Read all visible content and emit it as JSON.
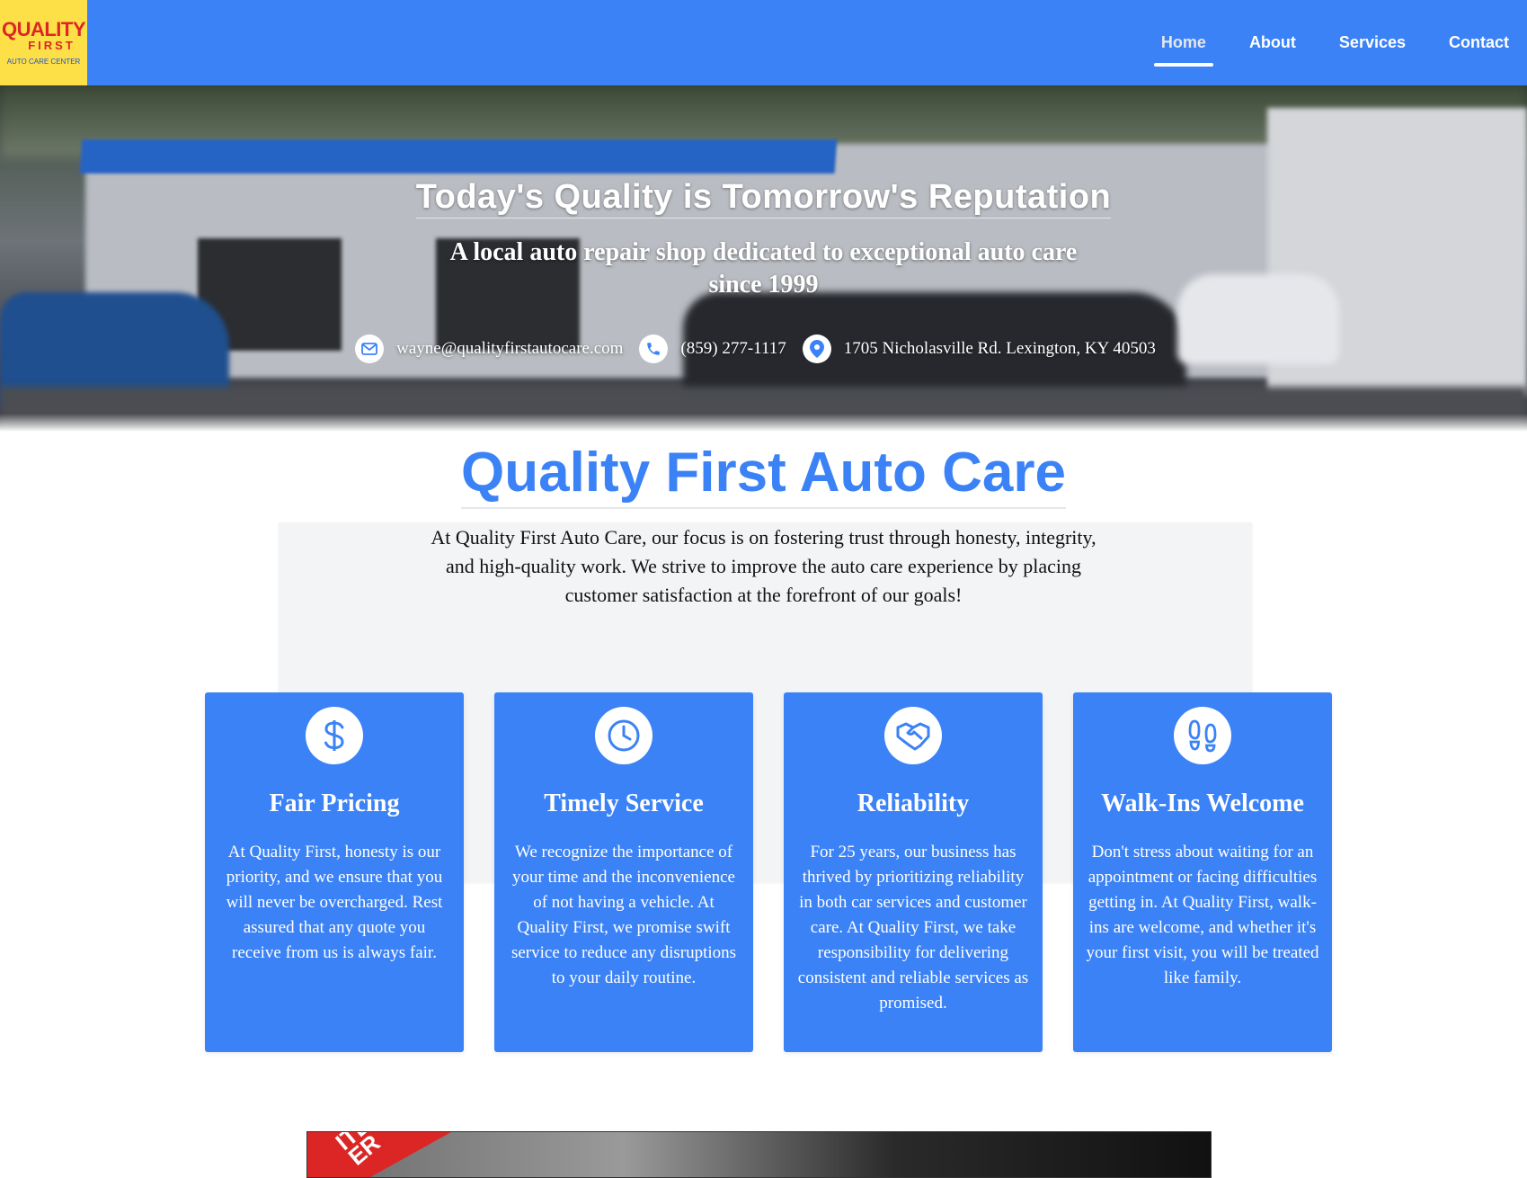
{
  "brand": {
    "logo_line1": "QUALITY",
    "logo_line2": "FIRST",
    "logo_line3": "AUTO CARE CENTER",
    "colors": {
      "primary": "#3b82f6",
      "logo_bg": "#fde047",
      "logo_red": "#dc2626"
    }
  },
  "nav": {
    "items": [
      {
        "label": "Home",
        "active": true
      },
      {
        "label": "About",
        "active": false
      },
      {
        "label": "Services",
        "active": false
      },
      {
        "label": "Contact",
        "active": false
      }
    ]
  },
  "hero": {
    "title": "Today's Quality is Tomorrow's Reputation",
    "subtitle_line1": "A local auto repair shop dedicated to exceptional auto care",
    "subtitle_line2": "since 1999",
    "email": "wayne@qualityfirstautocare.com",
    "phone": "(859) 277-1117",
    "address": "1705 Nicholasville Rd. Lexington, KY 40503",
    "icons": [
      "envelope-icon",
      "phone-icon",
      "location-pin-icon"
    ]
  },
  "main": {
    "title": "Quality First Auto Care",
    "intro_line1": "At Quality First Auto Care, our focus is on fostering trust through honesty, integrity,",
    "intro_line2": "and high-quality work. We strive to improve the auto care experience by placing",
    "intro_line3": "customer satisfaction at the forefront of our goals!"
  },
  "features": [
    {
      "icon": "dollar-icon",
      "title": "Fair Pricing",
      "text": "At Quality First, honesty is our priority, and we ensure that you will never be overcharged. Rest assured that any quote you receive from us is always fair."
    },
    {
      "icon": "clock-icon",
      "title": "Timely Service",
      "text": "We recognize the importance of your time and the inconvenience of not having a vehicle. At Quality First, we promise swift service to reduce any disruptions to your daily routine."
    },
    {
      "icon": "handshake-icon",
      "title": "Reliability",
      "text": "For 25 years, our business has thrived by prioritizing reliability in both car services and customer care. At Quality First, we take responsibility for delivering consistent and reliable services as promised."
    },
    {
      "icon": "footprints-icon",
      "title": "Walk-Ins Welcome",
      "text": "Don't stress about waiting for an appointment or facing difficulties getting in. At Quality First, walk-ins are welcome, and whether it's your first visit, you will be treated like family."
    }
  ],
  "promo": {
    "ribbon_line1": "ITED",
    "ribbon_line2": "ER"
  }
}
